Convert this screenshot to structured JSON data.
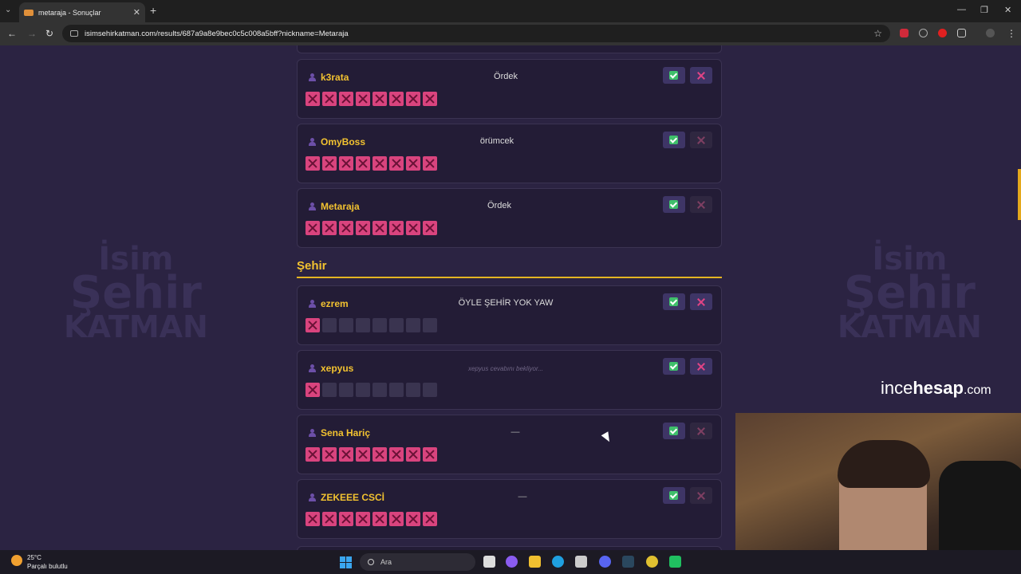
{
  "browser": {
    "tab_title": "metaraja - Sonuçlar",
    "url": "isimsehirkatman.com/results/687a9a8e9bec0c5c008a5bff?nickname=Metaraja"
  },
  "background": {
    "logo_line1": "İsim",
    "logo_line2": "Şehir",
    "logo_line3": "KATMAN"
  },
  "top_rows": [
    {
      "name": "k3rata",
      "answer": "Ördek",
      "votes": [
        "no",
        "no",
        "no",
        "no",
        "no",
        "no",
        "no",
        "no"
      ],
      "reject_active": true
    },
    {
      "name": "OmyBoss",
      "answer": "örümcek",
      "votes": [
        "no",
        "no",
        "no",
        "no",
        "no",
        "no",
        "no",
        "no"
      ],
      "reject_active": false
    },
    {
      "name": "Metaraja",
      "answer": "Ördek",
      "votes": [
        "no",
        "no",
        "no",
        "no",
        "no",
        "no",
        "no",
        "no"
      ],
      "reject_active": false
    }
  ],
  "section_title": "Şehir",
  "city_rows": [
    {
      "name": "ezrem",
      "answer": "ÖYLE ŞEHİR YOK YAW",
      "style": "normal",
      "votes": [
        "no",
        "empty",
        "empty",
        "empty",
        "empty",
        "empty",
        "empty",
        "empty"
      ],
      "reject_active": true
    },
    {
      "name": "xepyus",
      "answer": "xepyus cevabını bekliyor...",
      "style": "wait",
      "votes": [
        "no",
        "empty",
        "empty",
        "empty",
        "empty",
        "empty",
        "empty",
        "empty"
      ],
      "reject_active": true
    },
    {
      "name": "Sena Hariç",
      "answer": "—",
      "style": "dash",
      "votes": [
        "no",
        "no",
        "no",
        "no",
        "no",
        "no",
        "no",
        "no"
      ],
      "reject_active": false
    },
    {
      "name": "ZEKEEE CSCİ",
      "answer": "—",
      "style": "dash",
      "votes": [
        "no",
        "no",
        "no",
        "no",
        "no",
        "no",
        "no",
        "no"
      ],
      "reject_active": false
    }
  ],
  "overlay": {
    "brand_part1": "ince",
    "brand_part2": "hesap",
    "brand_part3": ".com"
  },
  "taskbar": {
    "temperature": "25°C",
    "weather_text": "Parçalı bulutlu",
    "search_placeholder": "Ara"
  }
}
